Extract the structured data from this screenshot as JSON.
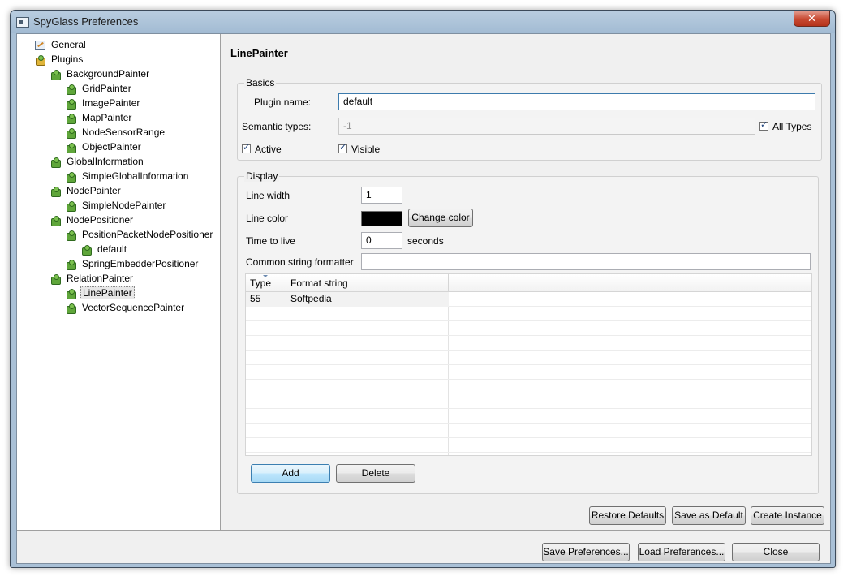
{
  "window": {
    "title": "SpyGlass Preferences",
    "close_symbol": "✕"
  },
  "tree": {
    "items": [
      {
        "label": "General"
      },
      {
        "label": "Plugins"
      },
      {
        "label": "BackgroundPainter"
      },
      {
        "label": "GridPainter"
      },
      {
        "label": "ImagePainter"
      },
      {
        "label": "MapPainter"
      },
      {
        "label": "NodeSensorRange"
      },
      {
        "label": "ObjectPainter"
      },
      {
        "label": "GlobalInformation"
      },
      {
        "label": "SimpleGlobalInformation"
      },
      {
        "label": "NodePainter"
      },
      {
        "label": "SimpleNodePainter"
      },
      {
        "label": "NodePositioner"
      },
      {
        "label": "PositionPacketNodePositioner"
      },
      {
        "label": "default"
      },
      {
        "label": "SpringEmbedderPositioner"
      },
      {
        "label": "RelationPainter"
      },
      {
        "label": "LinePainter"
      },
      {
        "label": "VectorSequencePainter"
      }
    ]
  },
  "panel": {
    "title": "LinePainter"
  },
  "basics": {
    "legend": "Basics",
    "plugin_name_label": "Plugin name:",
    "plugin_name_value": "default",
    "semantic_types_label": "Semantic types:",
    "semantic_types_value": "-1",
    "all_types_label": "All Types",
    "active_label": "Active",
    "visible_label": "Visible"
  },
  "display": {
    "legend": "Display",
    "line_width_label": "Line width",
    "line_width_value": "1",
    "line_color_label": "Line color",
    "line_color": "#000000",
    "change_color_label": "Change color",
    "ttl_label": "Time to live",
    "ttl_value": "0",
    "ttl_unit": "seconds",
    "formatter_label": "Common string formatter",
    "formatter_value": "",
    "table": {
      "columns": [
        "Type",
        "Format string"
      ],
      "rows": [
        {
          "type": "55",
          "format": "Softpedia"
        }
      ]
    },
    "add_label": "Add",
    "delete_label": "Delete"
  },
  "plugin_buttons": {
    "restore": "Restore Defaults",
    "save_default": "Save as Default",
    "create": "Create Instance"
  },
  "footer": {
    "save_prefs": "Save Preferences...",
    "load_prefs": "Load Preferences...",
    "close": "Close"
  }
}
